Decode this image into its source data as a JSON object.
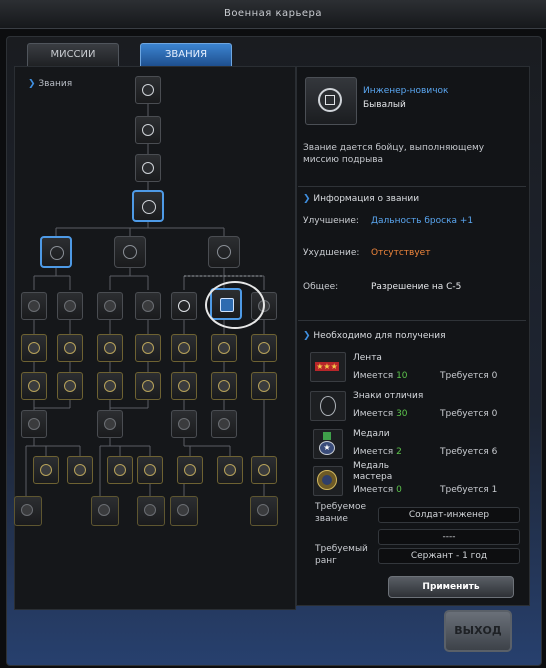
{
  "window": {
    "title": "Военная карьера"
  },
  "tabs": {
    "missions": "МИССИИ",
    "ranks": "ЗВАНИЯ"
  },
  "tree": {
    "label": "Звания"
  },
  "rank": {
    "name": "Инженер-новичок",
    "subtitle": "Бывалый",
    "description": "Звание дается бойцу, выполняющему миссию подрыва"
  },
  "rank_info": {
    "header": "Информация о звании",
    "upgrade_label": "Улучшение:",
    "upgrade_value": "Дальность броска +1",
    "downgrade_label": "Ухудшение:",
    "downgrade_value": "Отсутствует",
    "general_label": "Общее:",
    "general_value": "Разрешение на С-5"
  },
  "requirements": {
    "header": "Необходимо для получения",
    "have_label": "Имеется",
    "need_label": "Требуется",
    "items": [
      {
        "name": "Лента",
        "have": "10",
        "need": "0"
      },
      {
        "name": "Знаки отличия",
        "have": "30",
        "need": "0"
      },
      {
        "name": "Медали",
        "have": "2",
        "need": "6"
      },
      {
        "name": "Медаль мастера",
        "have": "0",
        "need": "1"
      }
    ],
    "required_rank_label": "Требуемое звание",
    "required_rank_value": "Солдат-инженер",
    "required_rank_value2": "----",
    "required_grade_label": "Требуемый ранг",
    "required_grade_value": "Сержант - 1 год"
  },
  "buttons": {
    "apply": "Применить",
    "exit": "ВЫХОД"
  },
  "colors": {
    "accent": "#5aa6f0",
    "have": "#5cc44c",
    "negative": "#f0863c"
  },
  "icons": [
    "rank-insignia-icon",
    "ribbon-icon",
    "badge-icon",
    "medal-icon",
    "master-medal-icon"
  ]
}
